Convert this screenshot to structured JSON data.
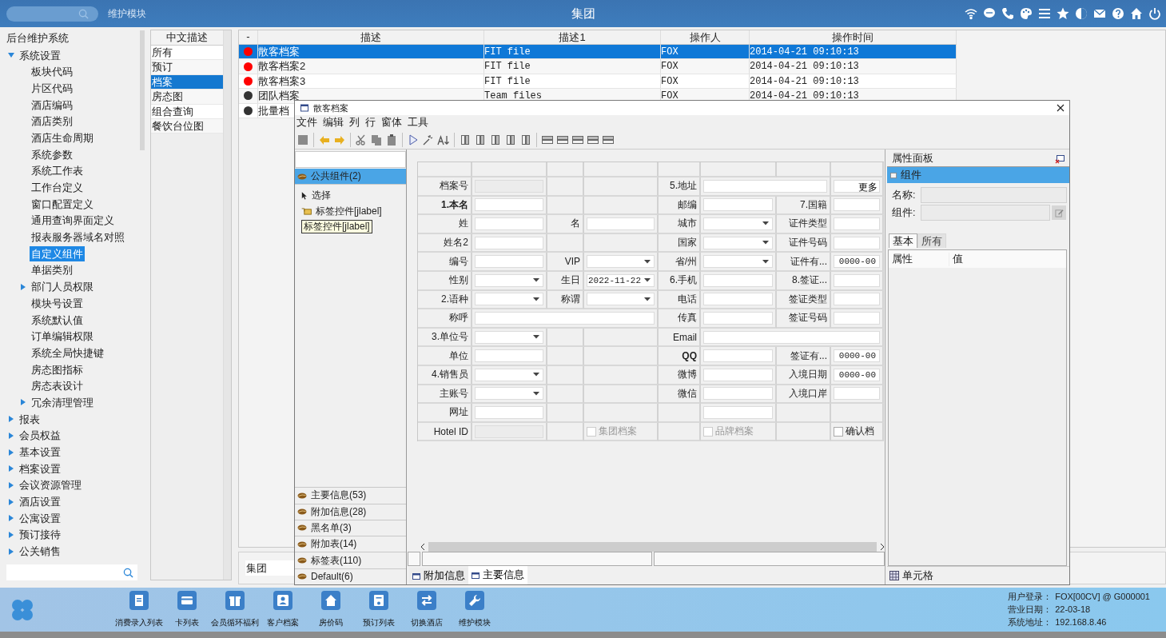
{
  "topbar": {
    "module": "维护模块",
    "title": "集团"
  },
  "sidebar": {
    "title": "后台维护系统",
    "items": [
      {
        "label": "系统设置",
        "expanded": true,
        "selected": false,
        "children": [
          {
            "label": "板块代码",
            "selected": false
          },
          {
            "label": "片区代码",
            "selected": false
          },
          {
            "label": "酒店编码",
            "selected": false
          },
          {
            "label": "酒店类别",
            "selected": false
          },
          {
            "label": "酒店生命周期",
            "selected": false
          },
          {
            "label": "系统参数",
            "selected": false
          },
          {
            "label": "系统工作表",
            "selected": false
          },
          {
            "label": "工作台定义",
            "selected": false
          },
          {
            "label": "窗口配置定义",
            "selected": false
          },
          {
            "label": "通用查询界面定义",
            "selected": false
          },
          {
            "label": "报表服务器域名对照",
            "selected": false
          },
          {
            "label": "自定义组件",
            "selected": true
          },
          {
            "label": "单据类别",
            "selected": false
          },
          {
            "label": "部门人员权限",
            "expanded": false,
            "selected": false
          },
          {
            "label": "模块号设置",
            "selected": false
          },
          {
            "label": "系统默认值",
            "selected": false
          },
          {
            "label": "订单编辑权限",
            "selected": false
          },
          {
            "label": "系统全局快捷键",
            "selected": false
          },
          {
            "label": "房态图指标",
            "selected": false
          },
          {
            "label": "房态表设计",
            "selected": false
          },
          {
            "label": "冗余清理管理",
            "expanded": false,
            "selected": false
          }
        ]
      },
      {
        "label": "报表",
        "expanded": false,
        "selected": false
      },
      {
        "label": "会员权益",
        "expanded": false,
        "selected": false
      },
      {
        "label": "基本设置",
        "expanded": false,
        "selected": false
      },
      {
        "label": "档案设置",
        "expanded": false,
        "selected": false
      },
      {
        "label": "会议资源管理",
        "expanded": false,
        "selected": false
      },
      {
        "label": "酒店设置",
        "expanded": false,
        "selected": false
      },
      {
        "label": "公寓设置",
        "expanded": false,
        "selected": false
      },
      {
        "label": "预订接待",
        "expanded": false,
        "selected": false
      },
      {
        "label": "公关销售",
        "expanded": false,
        "selected": false
      }
    ]
  },
  "category_list": {
    "header": "中文描述",
    "items": [
      {
        "label": "所有",
        "selected": false
      },
      {
        "label": "预订",
        "selected": false
      },
      {
        "label": "档案",
        "selected": true
      },
      {
        "label": "房态图",
        "selected": false
      },
      {
        "label": "组合查询",
        "selected": false
      },
      {
        "label": "餐饮台位图",
        "selected": false
      }
    ]
  },
  "table": {
    "columns": [
      "-",
      "描述",
      "描述1",
      "操作人",
      "操作时间"
    ],
    "rows": [
      {
        "color": "#ff0000",
        "selected": true,
        "cells": [
          "散客档案",
          "FIT file",
          "FOX",
          "2014-04-21 09:10:13"
        ]
      },
      {
        "color": "#ff0000",
        "selected": false,
        "cells": [
          "散客档案2",
          "FIT file",
          "FOX",
          "2014-04-21 09:10:13"
        ]
      },
      {
        "color": "#ff0000",
        "selected": false,
        "cells": [
          "散客档案3",
          "FIT file",
          "FOX",
          "2014-04-21 09:10:13"
        ]
      },
      {
        "color": "#333333",
        "selected": false,
        "cells": [
          "团队档案",
          "Team files",
          "FOX",
          "2014-04-21 09:10:13"
        ]
      },
      {
        "color": "#333333",
        "selected": false,
        "cells": [
          "批量档"
        ]
      }
    ]
  },
  "bottom_field": {
    "value": "集团"
  },
  "dialog": {
    "title": "散客档案",
    "menu": [
      "文件",
      "编辑",
      "列",
      "行",
      "窗体",
      "工具"
    ],
    "palette": {
      "groups_top": [
        {
          "label": "公共组件(2)",
          "selected": true
        }
      ],
      "items": [
        {
          "kind": "pointer",
          "label": "选择"
        },
        {
          "kind": "tag",
          "label": "标签控件[jlabel]"
        }
      ],
      "tooltip": "标签控件[jlabel]",
      "groups_bottom": [
        {
          "label": "主要信息(53)",
          "selected": false
        },
        {
          "label": "附加信息(28)",
          "selected": false
        },
        {
          "label": "黑名单(3)",
          "selected": false
        },
        {
          "label": "附加表(14)",
          "selected": false
        },
        {
          "label": "标签表(110)",
          "selected": false
        },
        {
          "label": "Default(6)",
          "selected": false
        }
      ]
    },
    "form_rows": [
      [
        {
          "kind": "label",
          "text": "档案号"
        },
        {
          "kind": "disabled"
        },
        {
          "kind": "blank"
        },
        {
          "kind": "blank"
        },
        {
          "kind": "label",
          "text": "5.地址"
        },
        {
          "kind": "double"
        },
        {
          "kind": "button",
          "text": "更多"
        }
      ],
      [
        {
          "kind": "label",
          "text": "1.本名",
          "bold": true
        },
        {
          "kind": "text"
        },
        {
          "kind": "blank"
        },
        {
          "kind": "blank"
        },
        {
          "kind": "label",
          "text": "邮编"
        },
        {
          "kind": "text"
        },
        {
          "kind": "label",
          "text": "7.国籍"
        },
        {
          "kind": "text"
        }
      ],
      [
        {
          "kind": "label",
          "text": "姓"
        },
        {
          "kind": "text"
        },
        {
          "kind": "label",
          "text": "名"
        },
        {
          "kind": "text"
        },
        {
          "kind": "label",
          "text": "城市"
        },
        {
          "kind": "select"
        },
        {
          "kind": "label",
          "text": "证件类型"
        },
        {
          "kind": "text"
        }
      ],
      [
        {
          "kind": "label",
          "text": "姓名2"
        },
        {
          "kind": "text"
        },
        {
          "kind": "blank"
        },
        {
          "kind": "blank"
        },
        {
          "kind": "label",
          "text": "国家"
        },
        {
          "kind": "select"
        },
        {
          "kind": "label",
          "text": "证件号码"
        },
        {
          "kind": "text"
        }
      ],
      [
        {
          "kind": "label",
          "text": "编号"
        },
        {
          "kind": "text"
        },
        {
          "kind": "label",
          "text": "VIP"
        },
        {
          "kind": "select"
        },
        {
          "kind": "label",
          "text": "省/州"
        },
        {
          "kind": "select"
        },
        {
          "kind": "label",
          "text": "证件有..."
        },
        {
          "kind": "date",
          "value": "0000-00"
        }
      ],
      [
        {
          "kind": "label",
          "text": "性别"
        },
        {
          "kind": "select"
        },
        {
          "kind": "label",
          "text": "生日"
        },
        {
          "kind": "select",
          "value": "2022-11-22"
        },
        {
          "kind": "label",
          "text": "6.手机"
        },
        {
          "kind": "text"
        },
        {
          "kind": "label",
          "text": "8.签证..."
        },
        {
          "kind": "text"
        }
      ],
      [
        {
          "kind": "label",
          "text": "2.语种"
        },
        {
          "kind": "select"
        },
        {
          "kind": "label",
          "text": "称谓"
        },
        {
          "kind": "select"
        },
        {
          "kind": "label",
          "text": "电话"
        },
        {
          "kind": "text"
        },
        {
          "kind": "label",
          "text": "签证类型"
        },
        {
          "kind": "text"
        }
      ],
      [
        {
          "kind": "label",
          "text": "称呼"
        },
        {
          "kind": "wide"
        },
        {
          "kind": "label",
          "text": "传真"
        },
        {
          "kind": "text"
        },
        {
          "kind": "label",
          "text": "签证号码"
        },
        {
          "kind": "text"
        }
      ],
      [
        {
          "kind": "label",
          "text": "3.单位号"
        },
        {
          "kind": "select"
        },
        {
          "kind": "blank"
        },
        {
          "kind": "blank"
        },
        {
          "kind": "label",
          "text": "Email"
        },
        {
          "kind": "wide"
        }
      ],
      [
        {
          "kind": "label",
          "text": "单位"
        },
        {
          "kind": "text"
        },
        {
          "kind": "blank"
        },
        {
          "kind": "blank"
        },
        {
          "kind": "label",
          "text": "QQ",
          "bold": true
        },
        {
          "kind": "text"
        },
        {
          "kind": "label",
          "text": "签证有..."
        },
        {
          "kind": "date",
          "value": "0000-00"
        }
      ],
      [
        {
          "kind": "label",
          "text": "4.销售员"
        },
        {
          "kind": "select"
        },
        {
          "kind": "blank"
        },
        {
          "kind": "blank"
        },
        {
          "kind": "label",
          "text": "微博"
        },
        {
          "kind": "text"
        },
        {
          "kind": "label",
          "text": "入境日期"
        },
        {
          "kind": "date",
          "value": "0000-00"
        }
      ],
      [
        {
          "kind": "label",
          "text": "主账号"
        },
        {
          "kind": "select"
        },
        {
          "kind": "blank"
        },
        {
          "kind": "blank"
        },
        {
          "kind": "label",
          "text": "微信"
        },
        {
          "kind": "text"
        },
        {
          "kind": "label",
          "text": "入境口岸"
        },
        {
          "kind": "text"
        }
      ],
      [
        {
          "kind": "label",
          "text": "网址"
        },
        {
          "kind": "text"
        },
        {
          "kind": "blank"
        },
        {
          "kind": "blank"
        },
        {
          "kind": "blank"
        },
        {
          "kind": "text"
        },
        {
          "kind": "blank"
        },
        {
          "kind": "blank"
        }
      ],
      [
        {
          "kind": "label",
          "text": "Hotel ID"
        },
        {
          "kind": "disabled"
        },
        {
          "kind": "blank"
        },
        {
          "kind": "check",
          "text": "集团档案",
          "checked": false,
          "disabled": true
        },
        {
          "kind": "blank"
        },
        {
          "kind": "check",
          "text": "品牌档案",
          "checked": false,
          "disabled": true
        },
        {
          "kind": "blank"
        },
        {
          "kind": "check",
          "text": "确认档",
          "checked": false,
          "disabled": false
        }
      ]
    ],
    "bottom_tabs": [
      {
        "label": "附加信息",
        "selected": false
      },
      {
        "label": "主要信息",
        "selected": true
      }
    ],
    "properties": {
      "title": "属性面板",
      "section": {
        "label": "组件",
        "selected": true
      },
      "name_label": "名称:",
      "component_label": "组件:",
      "tabs": [
        {
          "label": "基本",
          "selected": true
        },
        {
          "label": "所有",
          "selected": false
        }
      ],
      "columns": [
        "属性",
        "值"
      ],
      "footer": "单元格"
    }
  },
  "taskbar": {
    "buttons": [
      "消费录入列表",
      "卡列表",
      "会员循环福利",
      "客户档案",
      "房价码",
      "预订列表",
      "切换酒店",
      "维护模块"
    ],
    "status": [
      {
        "label": "用户登录：",
        "value": "FOX[00CV] @ G000001"
      },
      {
        "label": "营业日期：",
        "value": "22-03-18"
      },
      {
        "label": "系统地址：",
        "value": "192.168.8.46"
      }
    ]
  }
}
